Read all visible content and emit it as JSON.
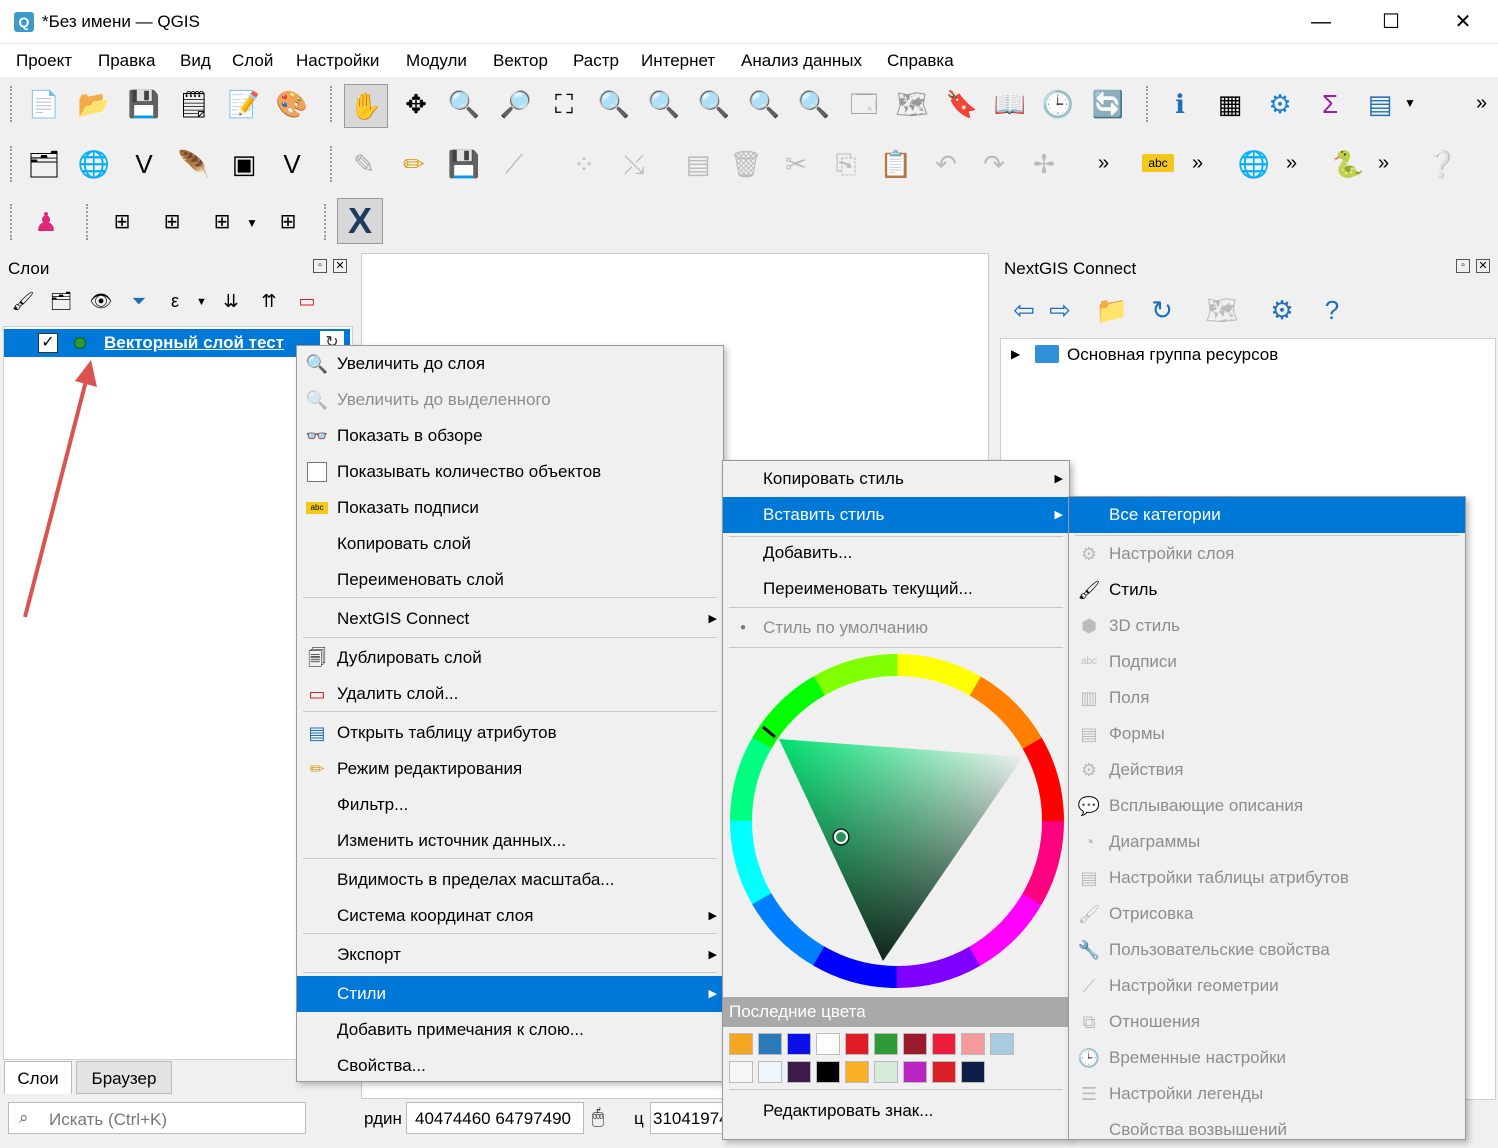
{
  "window": {
    "title": "*Без имени — QGIS",
    "minimize": "—",
    "maximize": "☐",
    "close": "✕"
  },
  "menubar": [
    "Проект",
    "Правка",
    "Вид",
    "Слой",
    "Настройки",
    "Модули",
    "Вектор",
    "Растр",
    "Интернет",
    "Анализ данных",
    "Справка"
  ],
  "toolbar": {
    "overflow": "»"
  },
  "layers_panel": {
    "title": "Слои",
    "layer_name": "Векторный слой тест",
    "checkbox": "✓"
  },
  "ngc_panel": {
    "title": "NextGIS Connect",
    "root_group": "Основная группа ресурсов"
  },
  "context_menu": [
    {
      "label": "Увеличить до слоя",
      "icon": "zoom-to-layer-icon",
      "state": "normal"
    },
    {
      "label": "Увеличить до выделенного",
      "icon": "zoom-to-selection-icon",
      "state": "disabled"
    },
    {
      "label": "Показать в обзоре",
      "icon": "overview-glasses-icon",
      "state": "normal"
    },
    {
      "label": "Показывать количество объектов",
      "icon": "checkbox-icon",
      "state": "normal"
    },
    {
      "label": "Показать подписи",
      "icon": "labels-abc-icon",
      "state": "normal"
    },
    {
      "label": "Копировать слой",
      "icon": "",
      "state": "normal"
    },
    {
      "label": "Переименовать слой",
      "icon": "",
      "state": "normal"
    },
    {
      "label": "NextGIS Connect",
      "icon": "",
      "state": "submenu"
    },
    {
      "label": "Дублировать слой",
      "icon": "duplicate-layer-icon",
      "state": "normal"
    },
    {
      "label": "Удалить слой...",
      "icon": "remove-layer-icon",
      "state": "normal"
    },
    {
      "label": "Открыть таблицу атрибутов",
      "icon": "attribute-table-icon",
      "state": "normal"
    },
    {
      "label": "Режим редактирования",
      "icon": "pencil-icon",
      "state": "normal"
    },
    {
      "label": "Фильтр...",
      "icon": "",
      "state": "normal"
    },
    {
      "label": "Изменить источник данных...",
      "icon": "",
      "state": "normal"
    },
    {
      "label": "Видимость в пределах масштаба...",
      "icon": "",
      "state": "normal"
    },
    {
      "label": "Система координат слоя",
      "icon": "",
      "state": "submenu"
    },
    {
      "label": "Экспорт",
      "icon": "",
      "state": "submenu"
    },
    {
      "label": "Стили",
      "icon": "",
      "state": "selected"
    },
    {
      "label": "Добавить примечания к слою...",
      "icon": "",
      "state": "normal"
    },
    {
      "label": "Свойства...",
      "icon": "",
      "state": "normal"
    }
  ],
  "styles_submenu": {
    "copy_style": "Копировать стиль",
    "paste_style": "Вставить стиль",
    "add": "Добавить...",
    "rename_current": "Переименовать текущий...",
    "default_style": "Стиль по умолчанию",
    "recent_colors_label": "Последние цвета",
    "recent_colors": [
      "#f5a623",
      "#2a7ab9",
      "#0c10e8",
      "#ffffff",
      "#e01b24",
      "#2e9a36",
      "#9b1b2c",
      "#ec1d3a",
      "#f39a9a",
      "#a8cbe0",
      "#f6f6f6",
      "#eef5fb",
      "#3c1a4b",
      "#000000",
      "#f9b227",
      "#d7eadb",
      "#b925c1",
      "#d81f2a",
      "#0b1f4a"
    ],
    "edit_symbol": "Редактировать знак..."
  },
  "paste_submenu": [
    {
      "label": "Все категории",
      "state": "selected"
    },
    {
      "label": "Настройки слоя",
      "state": "disabled"
    },
    {
      "label": "Стиль",
      "state": "normal"
    },
    {
      "label": "3D стиль",
      "state": "disabled"
    },
    {
      "label": "Подписи",
      "state": "disabled"
    },
    {
      "label": "Поля",
      "state": "disabled"
    },
    {
      "label": "Формы",
      "state": "disabled"
    },
    {
      "label": "Действия",
      "state": "disabled"
    },
    {
      "label": "Всплывающие описания",
      "state": "disabled"
    },
    {
      "label": "Диаграммы",
      "state": "disabled"
    },
    {
      "label": "Настройки таблицы атрибутов",
      "state": "disabled"
    },
    {
      "label": "Отрисовка",
      "state": "disabled"
    },
    {
      "label": "Пользовательские свойства",
      "state": "disabled"
    },
    {
      "label": "Настройки геометрии",
      "state": "disabled"
    },
    {
      "label": "Отношения",
      "state": "disabled"
    },
    {
      "label": "Временные настройки",
      "state": "disabled"
    },
    {
      "label": "Настройки легенды",
      "state": "disabled"
    },
    {
      "label": "Свойства возвышений",
      "state": "disabled"
    }
  ],
  "bottom_tabs": {
    "layers": "Слои",
    "browser": "Браузер"
  },
  "statusbar": {
    "search_placeholder": "Искать (Ctrl+K)",
    "coord_label": "рдин",
    "coord_value": "40474460  64797490",
    "scale_label": "ц",
    "scale_value": "31041974"
  }
}
